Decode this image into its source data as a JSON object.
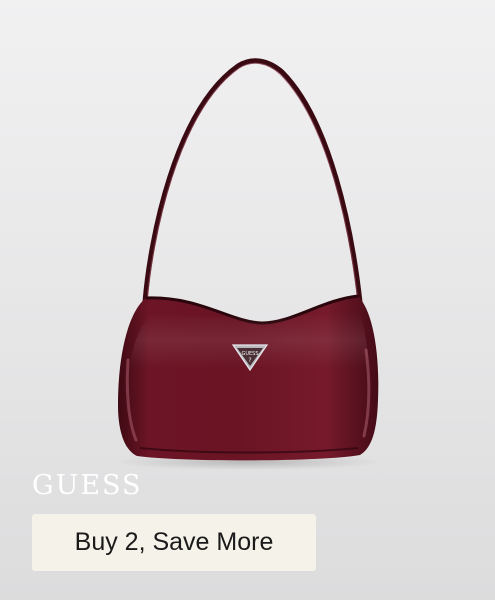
{
  "ad": {
    "brand": "GUESS",
    "cta_label": "Buy 2, Save More",
    "logo_text": "GUESS"
  },
  "colors": {
    "bag": "#6a1424",
    "cta_background": "#f5f2e9",
    "brand_text": "#ffffff",
    "background": "#e6e6e7"
  }
}
